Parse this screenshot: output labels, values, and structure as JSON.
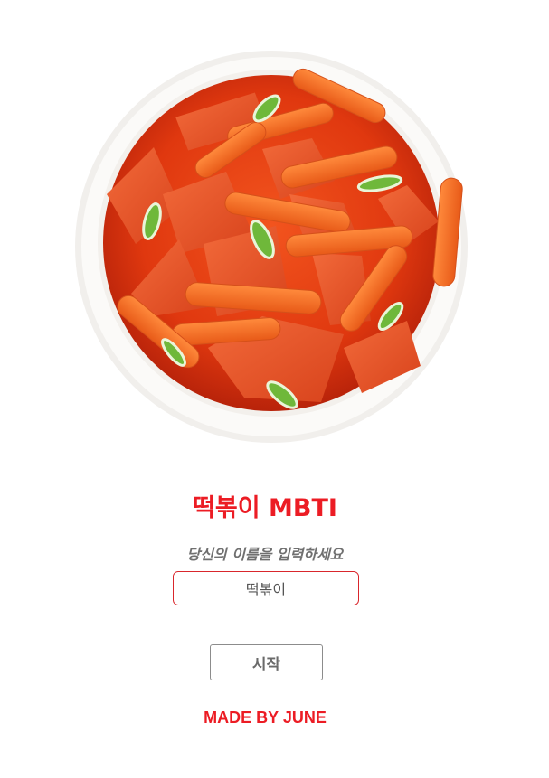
{
  "hero": {
    "image": "tteokbokki-bowl"
  },
  "title": "떡볶이 MBTI",
  "prompt": "당신의 이름을 입력하세요",
  "name_input": {
    "value": "떡볶이"
  },
  "start_button": {
    "label": "시작"
  },
  "footer": "MADE BY JUNE",
  "colors": {
    "accent": "#ec1c24",
    "input_border": "#d9262c",
    "button_border": "#8c8c8c",
    "prompt_text": "#707070"
  }
}
